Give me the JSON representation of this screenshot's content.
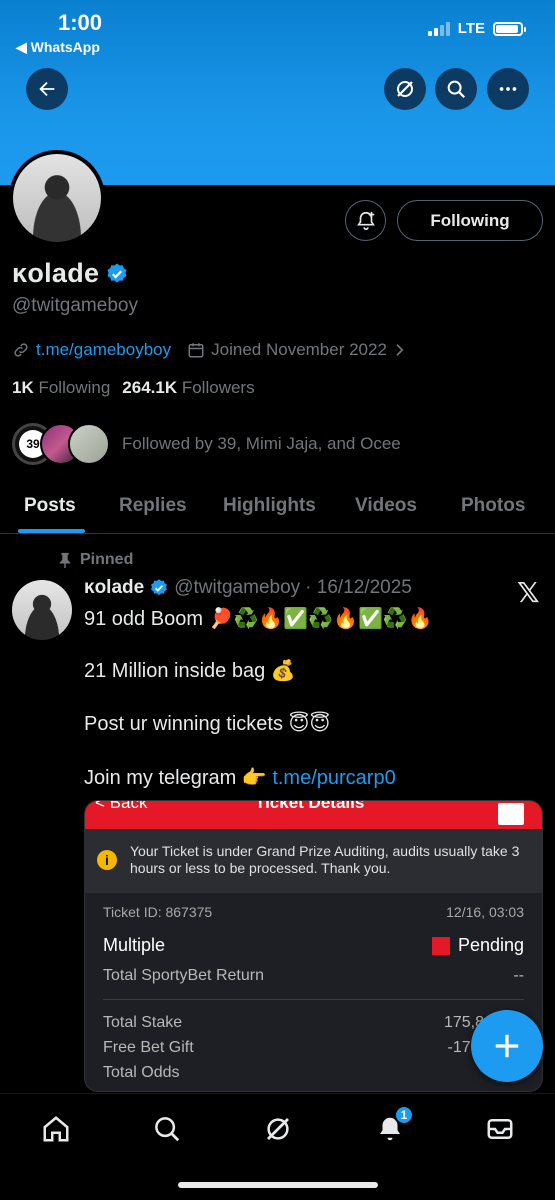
{
  "status_bar": {
    "time": "1:00",
    "back_app": "◀ WhatsApp",
    "network": "LTE"
  },
  "profile": {
    "name": "ĸolade",
    "handle": "@twitgameboy",
    "link": "t.me/gameboyboy",
    "joined": "Joined November 2022",
    "following_count": "1K",
    "following_label": "Following",
    "followers_count": "264.1K",
    "followers_label": "Followers",
    "followed_by_badge": "39",
    "followed_by_text": "Followed by 39, Mimi Jaja, and Ocee",
    "follow_button": "Following"
  },
  "tabs": [
    {
      "label": "Posts"
    },
    {
      "label": "Replies"
    },
    {
      "label": "Highlights"
    },
    {
      "label": "Videos"
    },
    {
      "label": "Photos"
    }
  ],
  "post": {
    "pinned_label": "Pinned",
    "author_name": "ĸolade",
    "author_handle": "@twitgameboy",
    "date": "· 16/12/2025",
    "line1_text": "91 odd Boom",
    "line1_emoji": "🏓♻️🔥✅♻️🔥✅♻️🔥",
    "line2_text": "21 Million inside bag",
    "line2_emoji": "💰",
    "line3_text": "Post ur winning tickets",
    "line3_emoji": "😇😇",
    "line4_text": "Join my telegram",
    "line4_emoji": "👉",
    "line4_link": "t.me/purcarp0",
    "x_logo": "𝕏"
  },
  "ticket": {
    "back": "< Back",
    "title": "Ticket Details",
    "notice": "Your Ticket is under Grand Prize Auditing, audits usually take 3 hours or less to be processed. Thank you.",
    "ticket_id": "Ticket ID: 867375",
    "date_time": "12/16, 03:03",
    "type": "Multiple",
    "status": "Pending",
    "return_label": "Total SportyBet Return",
    "return_value": "--",
    "stake_label": "Total Stake",
    "stake_value": "175,8",
    "gift_label": "Free Bet Gift",
    "gift_value": "-173,",
    "odds_label": "Total Odds"
  },
  "colors": {
    "accent": "#1d9bf0",
    "sporty_red": "#e41827",
    "muted": "#71767b",
    "text": "#e7e9ea"
  },
  "nav": {
    "notifications_badge": "1"
  }
}
